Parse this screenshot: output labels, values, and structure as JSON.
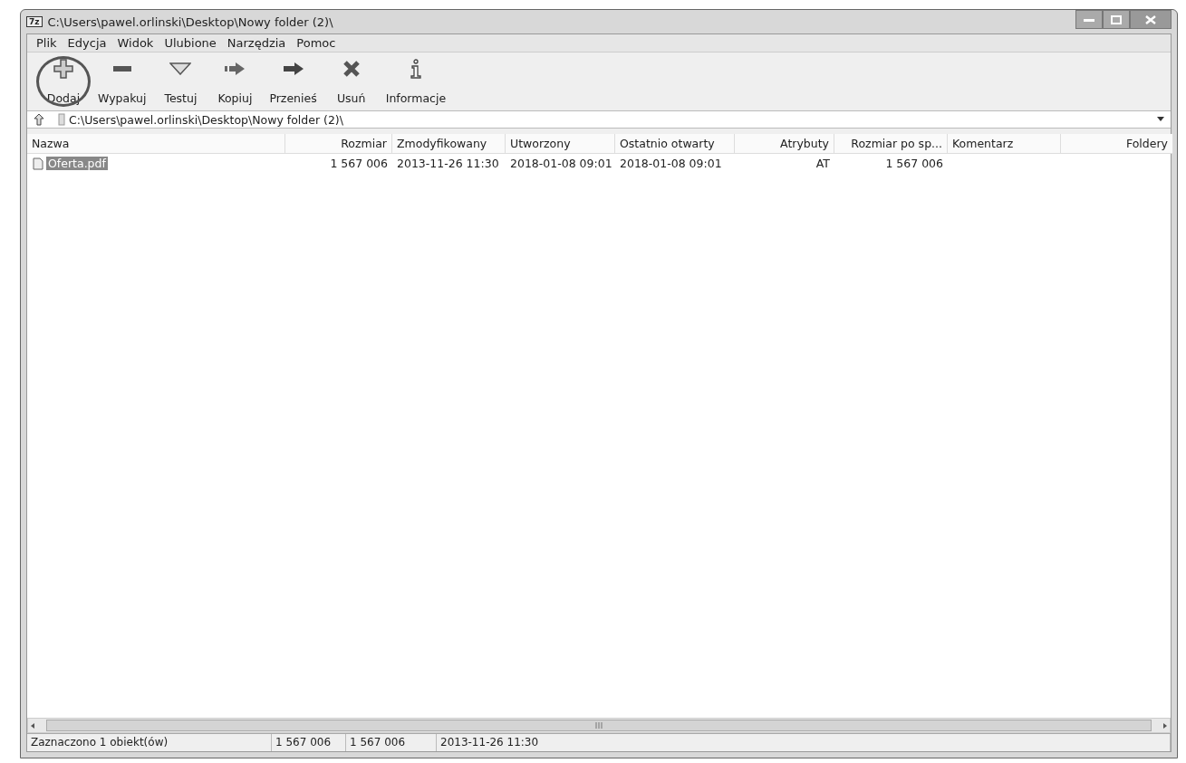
{
  "window": {
    "title": "C:\\Users\\pawel.orlinski\\Desktop\\Nowy folder (2)\\",
    "app_icon": "7z"
  },
  "menu": [
    {
      "label": "Plik"
    },
    {
      "label": "Edycja"
    },
    {
      "label": "Widok"
    },
    {
      "label": "Ulubione"
    },
    {
      "label": "Narzędzia"
    },
    {
      "label": "Pomoc"
    }
  ],
  "toolbar": [
    {
      "label": "Dodaj",
      "kind": "plus",
      "highlighted": true
    },
    {
      "label": "Wypakuj",
      "kind": "minus",
      "highlighted": false
    },
    {
      "label": "Testuj",
      "kind": "check",
      "highlighted": false
    },
    {
      "label": "Kopiuj",
      "kind": "copy",
      "highlighted": false
    },
    {
      "label": "Przenieś",
      "kind": "move",
      "highlighted": false
    },
    {
      "label": "Usuń",
      "kind": "delete",
      "highlighted": false
    },
    {
      "label": "Informacje",
      "kind": "info",
      "highlighted": false
    }
  ],
  "address": {
    "value": "C:\\Users\\pawel.orlinski\\Desktop\\Nowy folder (2)\\"
  },
  "table": {
    "columns": [
      {
        "label": "Nazwa"
      },
      {
        "label": "Rozmiar"
      },
      {
        "label": "Zmodyfikowany"
      },
      {
        "label": "Utworzony"
      },
      {
        "label": "Ostatnio otwarty"
      },
      {
        "label": "Atrybuty"
      },
      {
        "label": "Rozmiar po sp..."
      },
      {
        "label": "Komentarz"
      },
      {
        "label": "Foldery"
      }
    ],
    "rows": [
      {
        "selected": true,
        "cells": [
          "Oferta.pdf",
          "1 567 006",
          "2013-11-26 11:30",
          "2018-01-08 09:01",
          "2018-01-08 09:01",
          "AT",
          "1 567 006",
          "",
          ""
        ]
      }
    ]
  },
  "status_bar": [
    "Zaznaczono 1 obiekt(ów)",
    "1 567 006",
    "1 567 006",
    "2013-11-26 11:30"
  ]
}
